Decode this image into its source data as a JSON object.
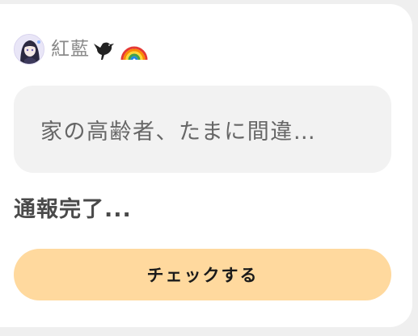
{
  "post": {
    "author_name": "紅藍",
    "author_emoji_1": "black-bird-icon",
    "author_emoji_2": "rainbow-icon",
    "quote_text": "家の高齢者、たまに間違…",
    "status_text": "通報完了...",
    "check_button_label": "チェックする"
  },
  "colors": {
    "card_background": "#ffffff",
    "page_background": "#efefef",
    "quote_background": "#f2f2f2",
    "button_background": "#ffd99e",
    "author_name_color": "#8a8a8a"
  }
}
